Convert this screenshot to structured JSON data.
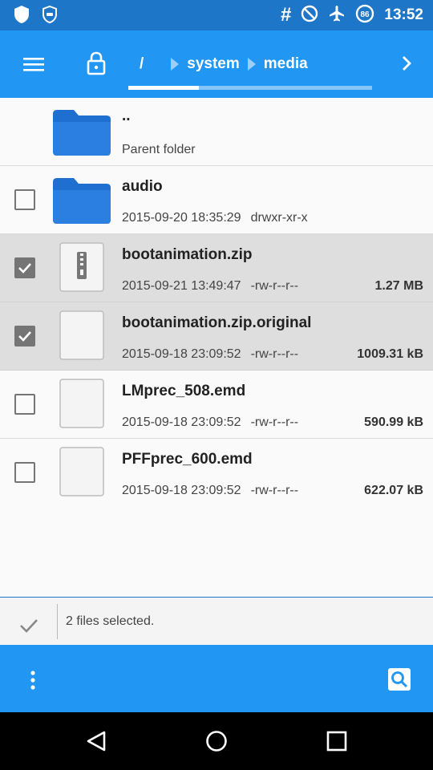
{
  "status_bar": {
    "time": "13:52",
    "hash_symbol": "#",
    "badge_number": "86",
    "icons": [
      "shield-icon",
      "cat-icon",
      "hash-icon",
      "do-not-disturb-icon",
      "airplane-icon",
      "data-saver-icon"
    ]
  },
  "toolbar": {
    "root": "/",
    "crumbs": [
      "system",
      "media"
    ],
    "menu_icon": "hamburger-icon",
    "lock_icon": "lock-icon",
    "forward_icon": "chevron-right-icon"
  },
  "files": [
    {
      "name": "..",
      "subtitle": "Parent folder",
      "type": "parent"
    },
    {
      "name": "audio",
      "date": "2015-09-20 18:35:29",
      "perm": "drwxr-xr-x",
      "size": "",
      "type": "folder",
      "selected": false
    },
    {
      "name": "bootanimation.zip",
      "date": "2015-09-21 13:49:47",
      "perm": "-rw-r--r--",
      "size": "1.27 MB",
      "type": "zip",
      "selected": true
    },
    {
      "name": "bootanimation.zip.original",
      "date": "2015-09-18 23:09:52",
      "perm": "-rw-r--r--",
      "size": "1009.31 kB",
      "type": "file",
      "selected": true
    },
    {
      "name": "LMprec_508.emd",
      "date": "2015-09-18 23:09:52",
      "perm": "-rw-r--r--",
      "size": "590.99 kB",
      "type": "file",
      "selected": false
    },
    {
      "name": "PFFprec_600.emd",
      "date": "2015-09-18 23:09:52",
      "perm": "-rw-r--r--",
      "size": "622.07 kB",
      "type": "file",
      "selected": false
    }
  ],
  "selection": {
    "text": "2 files selected."
  },
  "colors": {
    "primary": "#2196f3",
    "primary_dark": "#1e76c8",
    "folder": "#1f6fd0",
    "selected_row": "#dedede"
  }
}
